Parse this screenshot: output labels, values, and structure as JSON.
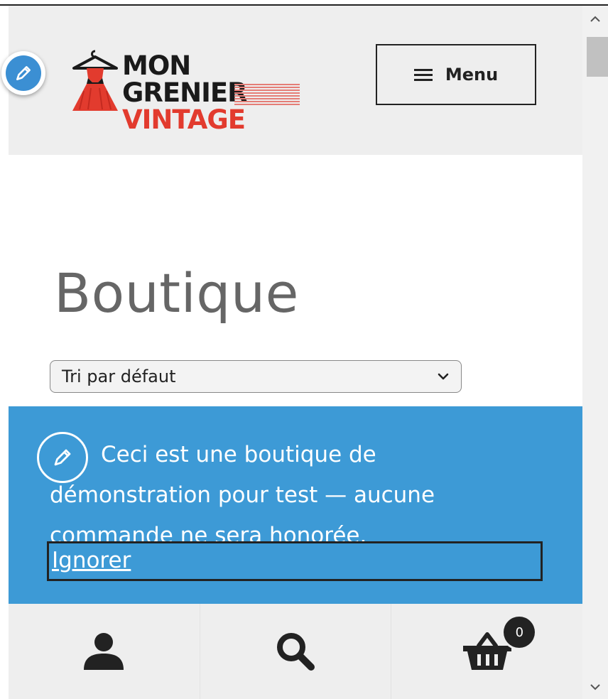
{
  "header": {
    "logo": {
      "line1": "MON GRENIER",
      "line2": "VINTAGE"
    },
    "menu_label": "Menu"
  },
  "page": {
    "title": "Boutique"
  },
  "sort": {
    "selected": "Tri par défaut"
  },
  "notice": {
    "text": "Ceci est une boutique de démonstration pour test — aucune commande ne sera honorée.",
    "dismiss_label": "Ignorer"
  },
  "bottom_bar": {
    "items": [
      {
        "icon": "user-icon"
      },
      {
        "icon": "search-icon"
      },
      {
        "icon": "cart-icon",
        "count": "0"
      }
    ]
  },
  "colors": {
    "header_bg": "#eeeeee",
    "notice_bg": "#3d9ad6",
    "edit_blue": "#3b8fd3",
    "logo_red": "#e23b2e",
    "title_gray": "#666666"
  }
}
